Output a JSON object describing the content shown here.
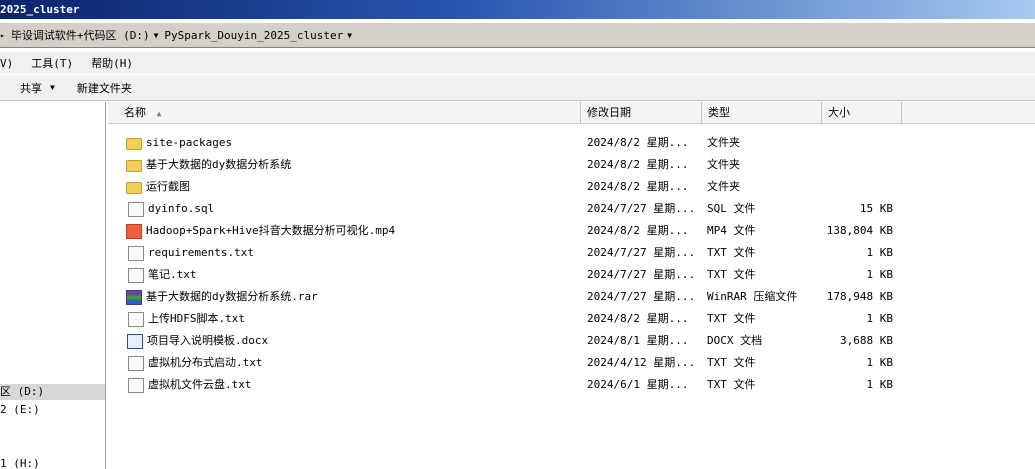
{
  "window": {
    "title": "2025_cluster"
  },
  "address": {
    "crumbs": [
      "毕设调试软件+代码区 (D:)",
      "PySpark_Douyin_2025_cluster"
    ]
  },
  "menu": [
    "V)",
    "工具(T)",
    "帮助(H)"
  ],
  "toolbar": {
    "share": "共享",
    "new_folder": "新建文件夹"
  },
  "nav": {
    "items": [
      {
        "label": "区 (D:)",
        "selected": true
      },
      {
        "label": "2 (E:)",
        "selected": false
      },
      {
        "label": "1 (H:)",
        "selected": false
      }
    ]
  },
  "columns": {
    "name": "名称",
    "date": "修改日期",
    "type": "类型",
    "size": "大小"
  },
  "files": [
    {
      "name": "site-packages",
      "date": "2024/8/2 星期...",
      "type": "文件夹",
      "size": "",
      "icon": "folder-icon"
    },
    {
      "name": "基于大数据的dy数据分析系统",
      "date": "2024/8/2 星期...",
      "type": "文件夹",
      "size": "",
      "icon": "folder-icon"
    },
    {
      "name": "运行截图",
      "date": "2024/8/2 星期...",
      "type": "文件夹",
      "size": "",
      "icon": "folder-icon"
    },
    {
      "name": "dyinfo.sql",
      "date": "2024/7/27 星期...",
      "type": "SQL 文件",
      "size": "15 KB",
      "icon": "sql-file-icon"
    },
    {
      "name": "Hadoop+Spark+Hive抖音大数据分析可视化.mp4",
      "date": "2024/8/2 星期...",
      "type": "MP4 文件",
      "size": "138,804 KB",
      "icon": "mp4-file-icon"
    },
    {
      "name": "requirements.txt",
      "date": "2024/7/27 星期...",
      "type": "TXT 文件",
      "size": "1 KB",
      "icon": "text-file-icon"
    },
    {
      "name": "笔记.txt",
      "date": "2024/7/27 星期...",
      "type": "TXT 文件",
      "size": "1 KB",
      "icon": "text-file-icon"
    },
    {
      "name": "基于大数据的dy数据分析系统.rar",
      "date": "2024/7/27 星期...",
      "type": "WinRAR 压缩文件",
      "size": "178,948 KB",
      "icon": "rar-archive-icon"
    },
    {
      "name": "上传HDFS脚本.txt",
      "date": "2024/8/2 星期...",
      "type": "TXT 文件",
      "size": "1 KB",
      "icon": "text-file-icon"
    },
    {
      "name": "项目导入说明模板.docx",
      "date": "2024/8/1 星期...",
      "type": "DOCX 文档",
      "size": "3,688 KB",
      "icon": "word-doc-icon"
    },
    {
      "name": "虚拟机分布式启动.txt",
      "date": "2024/4/12 星期...",
      "type": "TXT 文件",
      "size": "1 KB",
      "icon": "text-file-icon"
    },
    {
      "name": "虚拟机文件云盘.txt",
      "date": "2024/6/1 星期...",
      "type": "TXT 文件",
      "size": "1 KB",
      "icon": "text-file-icon"
    }
  ]
}
